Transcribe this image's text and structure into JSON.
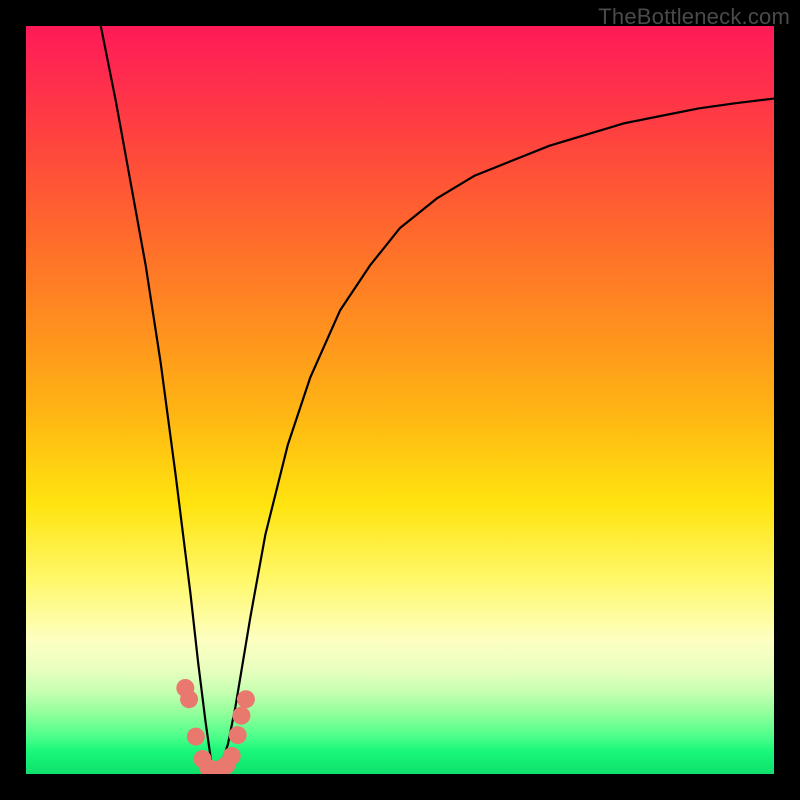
{
  "watermark": "TheBottleneck.com",
  "colors": {
    "frame": "#000000",
    "curve": "#000000",
    "point": "#e9796f"
  },
  "chart_data": {
    "type": "line",
    "title": "",
    "xlabel": "",
    "ylabel": "",
    "xlim": [
      0,
      100
    ],
    "ylim": [
      0,
      100
    ],
    "grid": false,
    "legend": false,
    "curve_minimum_x": 25,
    "series": [
      {
        "name": "bottleneck-curve",
        "x": [
          10,
          12,
          14,
          16,
          18,
          20,
          21,
          22,
          23,
          24,
          25,
          26,
          27,
          28,
          29,
          30,
          32,
          35,
          38,
          42,
          46,
          50,
          55,
          60,
          65,
          70,
          75,
          80,
          85,
          90,
          95,
          100
        ],
        "y": [
          100,
          90,
          79,
          68,
          55,
          40,
          32,
          24,
          15,
          7,
          0,
          1,
          4,
          9,
          15,
          21,
          32,
          44,
          53,
          62,
          68,
          73,
          77,
          80,
          82,
          84,
          85.5,
          87,
          88,
          89,
          89.7,
          90.3
        ]
      }
    ],
    "highlight_points": {
      "name": "marked-points",
      "x": [
        21.3,
        21.8,
        22.7,
        23.6,
        24.4,
        25.2,
        26.0,
        26.8,
        27.5,
        28.3,
        28.8,
        29.4
      ],
      "y": [
        11.5,
        10.0,
        5.0,
        2.0,
        0.8,
        0.5,
        0.7,
        1.2,
        2.4,
        5.2,
        7.8,
        10.0
      ]
    }
  }
}
